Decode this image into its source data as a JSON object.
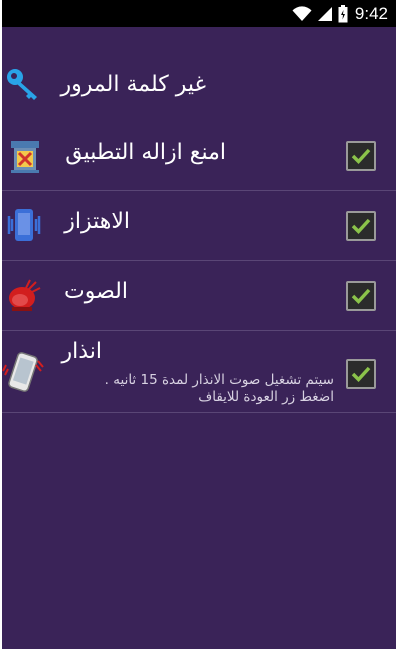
{
  "status_bar": {
    "time": "9:42"
  },
  "settings": [
    {
      "title": "غير كلمة المرور",
      "icon": "key-icon"
    },
    {
      "title": "امنع ازاله التطبيق",
      "icon": "uninstall-lock-icon",
      "checked": true
    },
    {
      "title": "الاهتزاز",
      "icon": "vibrate-icon",
      "checked": true
    },
    {
      "title": "الصوت",
      "icon": "siren-icon",
      "checked": true
    },
    {
      "title": "انذار",
      "summary": "سيتم تشغيل صوت الانذار لمدة 15 ثانيه . اضغط زر العودة للايقاف",
      "icon": "alarm-phone-icon",
      "checked": true
    }
  ],
  "colors": {
    "background": "#3a2358",
    "divider": "#5a4676",
    "check": "#8bc34a",
    "key": "#29a3e8"
  }
}
